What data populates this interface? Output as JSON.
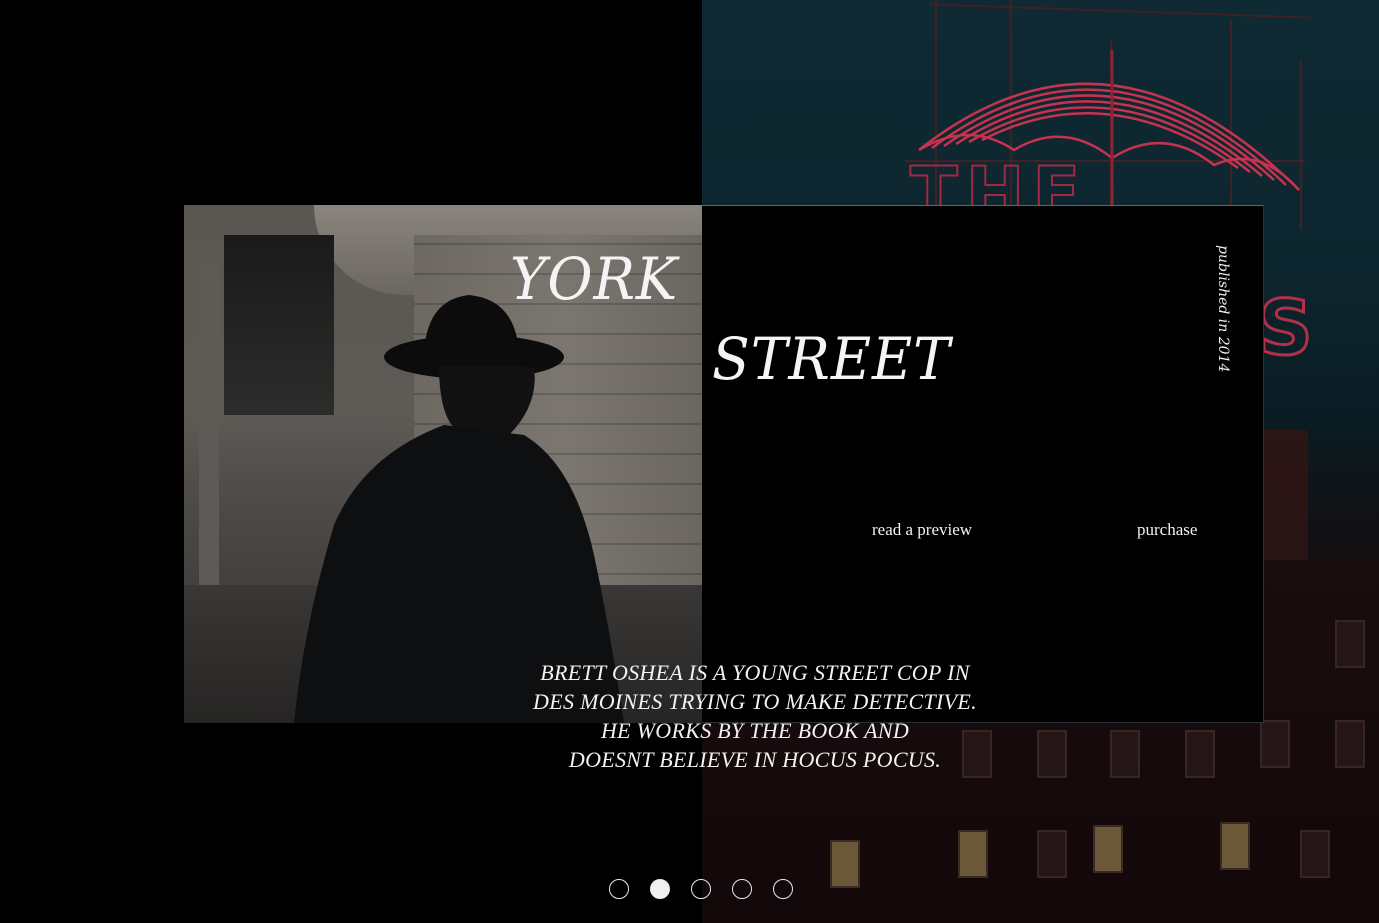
{
  "book": {
    "title_line1": "YORK",
    "title_line2": "STREET",
    "published": "published in 2014",
    "synopsis": [
      "BRETT OSHEA IS A YOUNG STREET COP IN",
      "DES MOINES TRYING TO MAKE DETECTIVE.",
      "HE WORKS BY THE BOOK AND",
      "DOESNT BELIEVE IN HOCUS POCUS."
    ]
  },
  "actions": {
    "preview_label": "read a preview",
    "purchase_label": "purchase"
  },
  "carousel": {
    "slide_count": 5,
    "active_index": 1
  },
  "colors": {
    "background": "#000000",
    "text": "#f2f2f2",
    "neon": "#b42f48",
    "sky": "#0f2a33"
  }
}
